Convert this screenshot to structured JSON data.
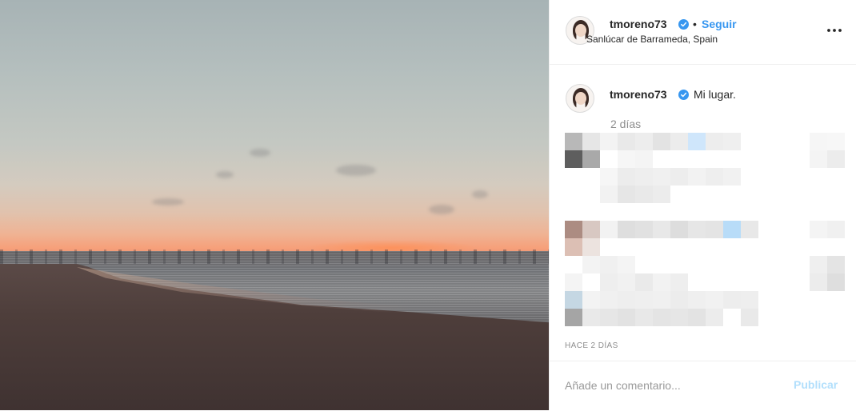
{
  "post": {
    "author": "tmoreno73",
    "follow_label": "Seguir",
    "header_separator": "•",
    "location": "Sanlúcar de Barrameda, Spain",
    "more_icon": "more-horizontal-icon",
    "verified_icon": "verified-badge-icon"
  },
  "caption": {
    "author": "tmoreno73",
    "text": "Mi lugar.",
    "time": "2 días"
  },
  "comments": {
    "blurred": true,
    "pixel_colors": [
      "#b8b8b8",
      "#e6e6e6",
      "#f0f0f0",
      "#cfe6fb",
      "#5e5e5e",
      "#a9a9a9",
      "#ac8c82",
      "#d8bfb4",
      "#c5d7e3",
      "#a5a5a5",
      "#b8dcf8"
    ]
  },
  "footer": {
    "age": "HACE 2 DÍAS",
    "comment_placeholder": "Añade un comentario...",
    "publish_label": "Publicar"
  },
  "colors": {
    "accent": "#3897f0",
    "publish_disabled": "#b2dffc",
    "muted_text": "#8e8e8e",
    "divider": "#efefef"
  }
}
